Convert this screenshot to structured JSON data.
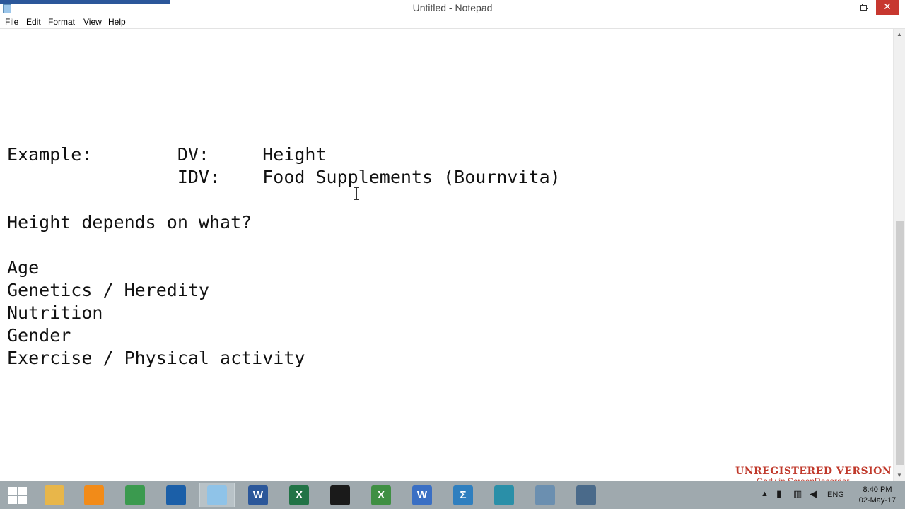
{
  "window": {
    "title": "Untitled - Notepad",
    "close_glyph": "✕"
  },
  "menu": [
    "File",
    "Edit",
    "Format",
    "View",
    "Help"
  ],
  "document": {
    "lines": [
      "Example:        DV:     Height",
      "                IDV:    Food Supplements (Bournvita)",
      "",
      "Height depends on what?",
      "",
      "Age",
      "Genetics / Heredity",
      "Nutrition",
      "Gender",
      "Exercise / Physical activity"
    ]
  },
  "watermark": {
    "line1": "UNREGISTERED VERSION",
    "line2": "Gadwin ScreenRecorder"
  },
  "taskbar": {
    "apps": [
      {
        "name": "file-explorer-icon",
        "color": "#e8b64a"
      },
      {
        "name": "vlc-icon",
        "color": "#f28b18"
      },
      {
        "name": "chrome-icon",
        "color": "#3b9a4f"
      },
      {
        "name": "virtualbox-icon",
        "color": "#1b5fa8"
      },
      {
        "name": "notepad-icon",
        "color": "#8fc3e8"
      },
      {
        "name": "word-icon",
        "color": "#2b579a",
        "letter": "W"
      },
      {
        "name": "excel-icon",
        "color": "#217346",
        "letter": "X"
      },
      {
        "name": "app-icon",
        "color": "#1a1a1a"
      },
      {
        "name": "excel-alt-icon",
        "color": "#3f8f43",
        "letter": "X"
      },
      {
        "name": "word-alt-icon",
        "color": "#3a6fc4",
        "letter": "W"
      },
      {
        "name": "math-icon",
        "color": "#2f7fbf",
        "letter": "Σ"
      },
      {
        "name": "network-icon",
        "color": "#2a8fa8"
      },
      {
        "name": "calculator-icon",
        "color": "#6b8fb0"
      },
      {
        "name": "remote-desktop-icon",
        "color": "#4a6a8a"
      }
    ],
    "tray_lang": "ENG",
    "time": "8:40 PM",
    "date": "02-May-17"
  }
}
